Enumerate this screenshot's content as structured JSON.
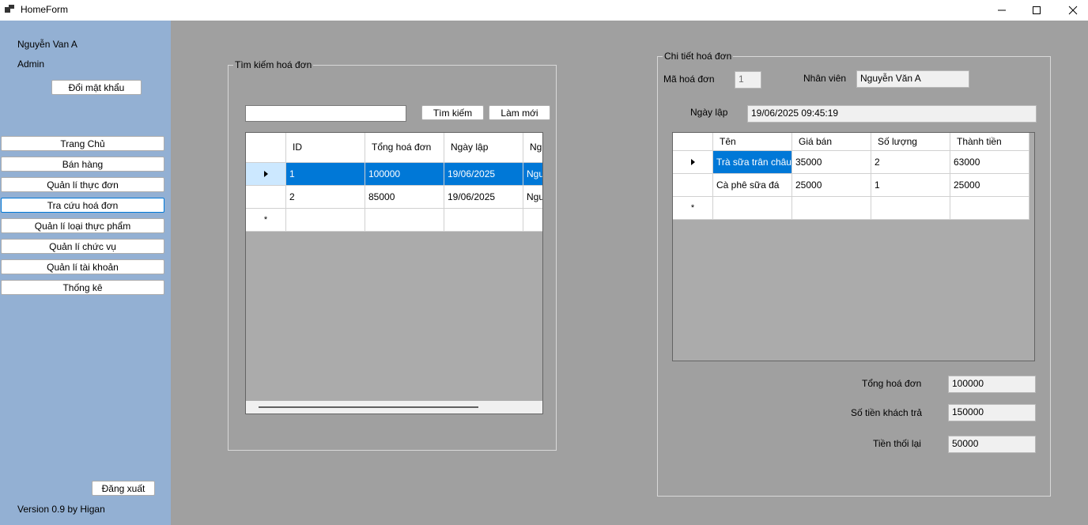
{
  "window": {
    "title": "HomeForm"
  },
  "sidebar": {
    "user_name": "Nguyễn Van A",
    "role": "Admin",
    "change_password": "Đổi mật khẩu",
    "nav": [
      {
        "label": "Trang Chủ"
      },
      {
        "label": "Bán hàng"
      },
      {
        "label": "Quản lí thực đơn"
      },
      {
        "label": "Tra cứu hoá đơn"
      },
      {
        "label": "Quản lí loại thực phẩm"
      },
      {
        "label": "Quản lí chức vụ"
      },
      {
        "label": "Quản lí tài khoản"
      },
      {
        "label": "Thống kê"
      }
    ],
    "active_nav": "Tra cứu hoá đơn",
    "logout": "Đăng xuất",
    "version": "Version 0.9 by Higan"
  },
  "search": {
    "group_title": "Tìm kiếm hoá đơn",
    "query": "",
    "search_button": "Tìm kiếm",
    "refresh_button": "Làm mới",
    "columns": [
      "ID",
      "Tổng hoá đơn",
      "Ngày lập",
      "Ng"
    ],
    "rows": [
      {
        "id": "1",
        "total": "100000",
        "date": "19/06/2025",
        "extra": "Ngu"
      },
      {
        "id": "2",
        "total": "85000",
        "date": "19/06/2025",
        "extra": "Ngu"
      }
    ]
  },
  "detail": {
    "group_title": "Chi tiết hoá đơn",
    "invoice_id_label": "Mã hoá đơn",
    "invoice_id": "1",
    "staff_label": "Nhân viên",
    "staff": "Nguyễn Văn A",
    "date_label": "Ngày lập",
    "date": "19/06/2025 09:45:19",
    "columns": [
      "Tên",
      "Giá bán",
      "Số lượng",
      "Thành tiền"
    ],
    "rows": [
      {
        "name": "Trà sữa trân châu",
        "price": "35000",
        "qty": "2",
        "amount": "63000"
      },
      {
        "name": "Cà phê sữa đá",
        "price": "25000",
        "qty": "1",
        "amount": "25000"
      }
    ],
    "total_label": "Tổng hoá đơn",
    "total": "100000",
    "paid_label": "Số tiền khách trả",
    "paid": "150000",
    "change_label": "Tiền thối lại",
    "change": "50000"
  },
  "colors": {
    "sidebar": "#93b0d3",
    "workspace": "#a0a0a0",
    "selection": "#0078d7"
  }
}
